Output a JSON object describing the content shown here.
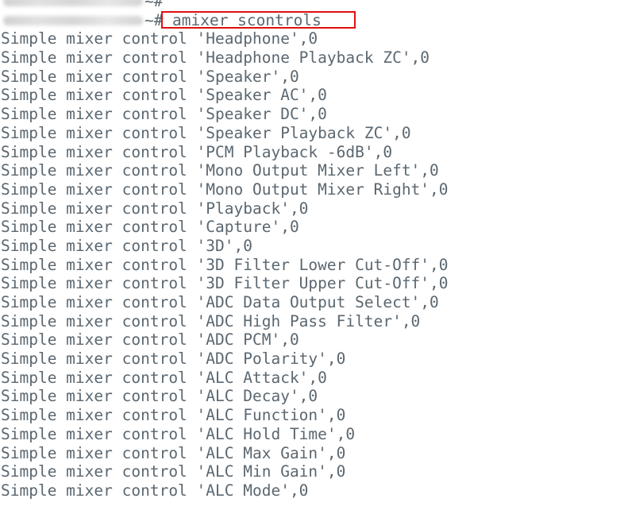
{
  "terminal": {
    "prompt_symbol": "~#",
    "command": "amixer scontrols",
    "highlight_color": "#e01010",
    "text_color": "#5b6770",
    "output_lines": [
      "Simple mixer control 'Headphone',0",
      "Simple mixer control 'Headphone Playback ZC',0",
      "Simple mixer control 'Speaker',0",
      "Simple mixer control 'Speaker AC',0",
      "Simple mixer control 'Speaker DC',0",
      "Simple mixer control 'Speaker Playback ZC',0",
      "Simple mixer control 'PCM Playback -6dB',0",
      "Simple mixer control 'Mono Output Mixer Left',0",
      "Simple mixer control 'Mono Output Mixer Right',0",
      "Simple mixer control 'Playback',0",
      "Simple mixer control 'Capture',0",
      "Simple mixer control '3D',0",
      "Simple mixer control '3D Filter Lower Cut-Off',0",
      "Simple mixer control '3D Filter Upper Cut-Off',0",
      "Simple mixer control 'ADC Data Output Select',0",
      "Simple mixer control 'ADC High Pass Filter',0",
      "Simple mixer control 'ADC PCM',0",
      "Simple mixer control 'ADC Polarity',0",
      "Simple mixer control 'ALC Attack',0",
      "Simple mixer control 'ALC Decay',0",
      "Simple mixer control 'ALC Function',0",
      "Simple mixer control 'ALC Hold Time',0",
      "Simple mixer control 'ALC Max Gain',0",
      "Simple mixer control 'ALC Min Gain',0",
      "Simple mixer control 'ALC Mode',0"
    ]
  }
}
